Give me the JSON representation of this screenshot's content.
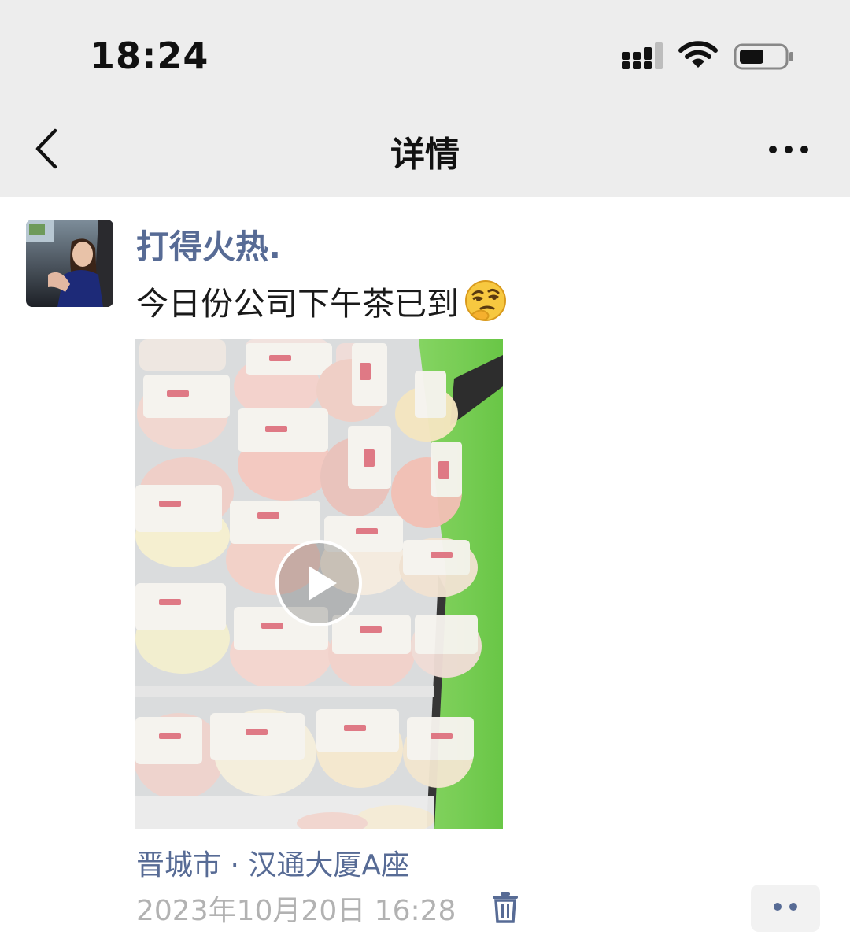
{
  "status_bar": {
    "time": "18:24"
  },
  "nav": {
    "title": "详情"
  },
  "post": {
    "username": "打得火热.",
    "text": "今日份公司下午茶已到",
    "location": "晋城市 · 汉通大厦A座",
    "timestamp": "2023年10月20日 16:28"
  },
  "colors": {
    "link": "#576b95",
    "topbar_bg": "#ededed",
    "meta_gray": "#b2b2b2"
  },
  "icons": [
    "signal-icon",
    "wifi-icon",
    "battery-icon",
    "back-chevron-icon",
    "more-icon",
    "play-icon",
    "thinking-emoji-icon",
    "trash-icon",
    "ellipsis-icon"
  ]
}
